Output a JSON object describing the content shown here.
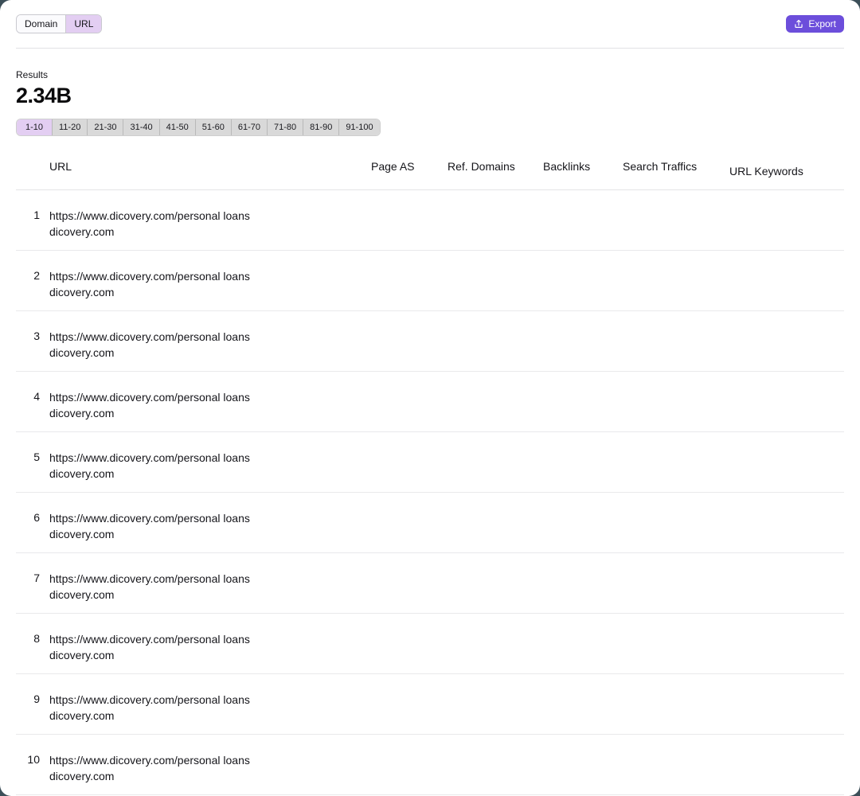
{
  "toolbar": {
    "segmented": {
      "options": [
        {
          "label": "Domain",
          "active": false
        },
        {
          "label": "URL",
          "active": true
        }
      ]
    },
    "export": {
      "label": "Export",
      "icon": "upload-icon",
      "bg_color": "#6c4edb",
      "text_color": "#ffffff"
    }
  },
  "results": {
    "label": "Results",
    "value": "2.34B"
  },
  "pagination": {
    "active_color": "#e3cef2",
    "inactive_color": "#d9d9d9",
    "pages": [
      {
        "label": "1-10",
        "active": true
      },
      {
        "label": "11-20",
        "active": false
      },
      {
        "label": "21-30",
        "active": false
      },
      {
        "label": "31-40",
        "active": false
      },
      {
        "label": "41-50",
        "active": false
      },
      {
        "label": "51-60",
        "active": false
      },
      {
        "label": "61-70",
        "active": false
      },
      {
        "label": "71-80",
        "active": false
      },
      {
        "label": "81-90",
        "active": false
      },
      {
        "label": "91-100",
        "active": false
      }
    ]
  },
  "table": {
    "headers": {
      "rank": "",
      "url": "URL",
      "page_as": "Page AS",
      "ref_domains": "Ref. Domains",
      "backlinks": "Backlinks",
      "search_traffics": "Search Traffics",
      "url_keywords": "URL Keywords"
    },
    "rows": [
      {
        "rank": "1",
        "url": "https://www.dicovery.com/personal loans",
        "domain": "dicovery.com",
        "page_as": "",
        "ref_domains": "",
        "backlinks": "",
        "search_traffics": "",
        "url_keywords": ""
      },
      {
        "rank": "2",
        "url": "https://www.dicovery.com/personal loans",
        "domain": "dicovery.com",
        "page_as": "",
        "ref_domains": "",
        "backlinks": "",
        "search_traffics": "",
        "url_keywords": ""
      },
      {
        "rank": "3",
        "url": "https://www.dicovery.com/personal loans",
        "domain": "dicovery.com",
        "page_as": "",
        "ref_domains": "",
        "backlinks": "",
        "search_traffics": "",
        "url_keywords": ""
      },
      {
        "rank": "4",
        "url": "https://www.dicovery.com/personal loans",
        "domain": "dicovery.com",
        "page_as": "",
        "ref_domains": "",
        "backlinks": "",
        "search_traffics": "",
        "url_keywords": ""
      },
      {
        "rank": "5",
        "url": "https://www.dicovery.com/personal loans",
        "domain": "dicovery.com",
        "page_as": "",
        "ref_domains": "",
        "backlinks": "",
        "search_traffics": "",
        "url_keywords": ""
      },
      {
        "rank": "6",
        "url": "https://www.dicovery.com/personal loans",
        "domain": "dicovery.com",
        "page_as": "",
        "ref_domains": "",
        "backlinks": "",
        "search_traffics": "",
        "url_keywords": ""
      },
      {
        "rank": "7",
        "url": "https://www.dicovery.com/personal loans",
        "domain": "dicovery.com",
        "page_as": "",
        "ref_domains": "",
        "backlinks": "",
        "search_traffics": "",
        "url_keywords": ""
      },
      {
        "rank": "8",
        "url": "https://www.dicovery.com/personal loans",
        "domain": "dicovery.com",
        "page_as": "",
        "ref_domains": "",
        "backlinks": "",
        "search_traffics": "",
        "url_keywords": ""
      },
      {
        "rank": "9",
        "url": "https://www.dicovery.com/personal loans",
        "domain": "dicovery.com",
        "page_as": "",
        "ref_domains": "",
        "backlinks": "",
        "search_traffics": "",
        "url_keywords": ""
      },
      {
        "rank": "10",
        "url": "https://www.dicovery.com/personal loans",
        "domain": "dicovery.com",
        "page_as": "",
        "ref_domains": "",
        "backlinks": "",
        "search_traffics": "",
        "url_keywords": ""
      }
    ]
  }
}
